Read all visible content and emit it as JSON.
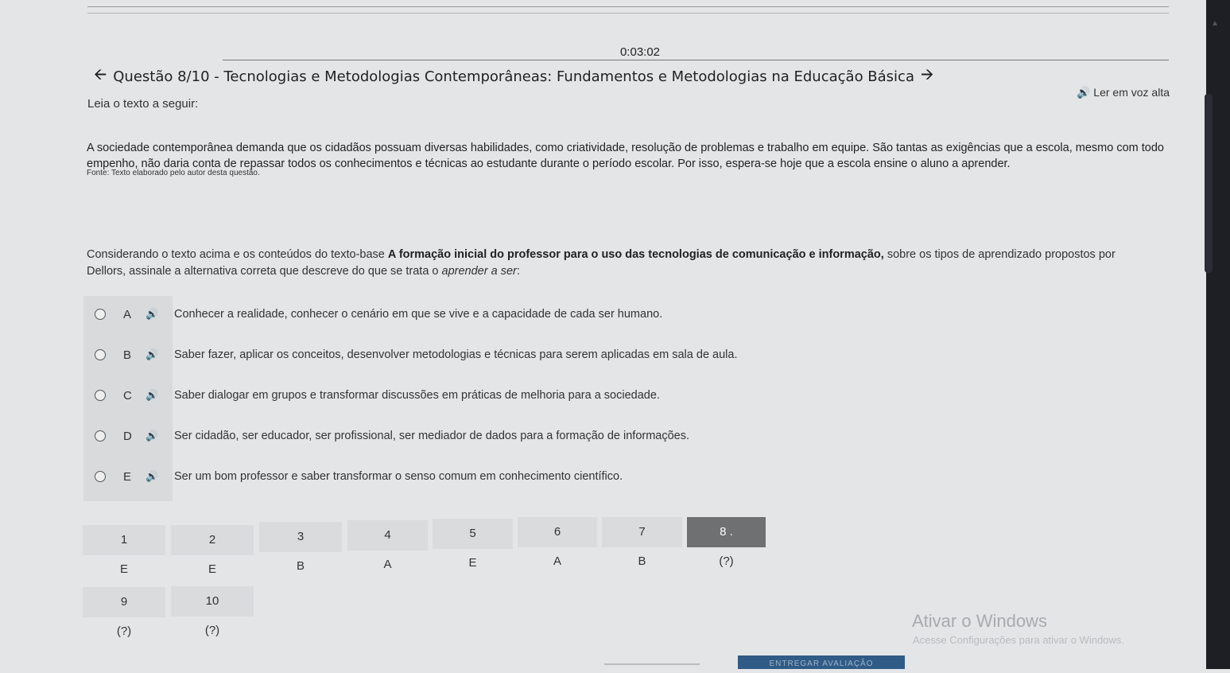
{
  "timer": "0:03:02",
  "question_title": "Questão 8/10 - Tecnologias e Metodologias Contemporâneas: Fundamentos e Metodologias na Educação Básica",
  "read_aloud_label": "Ler em voz alta",
  "lead": "Leia o texto a seguir:",
  "text_body": "A sociedade contemporânea demanda que os cidadãos possuam diversas habilidades, como criatividade, resolução de problemas e trabalho em equipe. São tantas as exigências que a escola, mesmo com todo empenho, não daria conta de repassar todos os conhecimentos e técnicas ao estudante durante o período escolar. Por isso, espera-se hoje que a escola ensine o aluno a aprender.",
  "source": "Fonte: Texto elaborado pelo autor desta questão.",
  "prompt": {
    "before": "Considerando o texto acima e os conteúdos do texto-base ",
    "bold": "A formação inicial do professor para o uso das tecnologias de comunicação e informação,",
    "after": " sobre os tipos de aprendizado propostos por Dellors, assinale a alternativa correta que descreve do que se trata o ",
    "italic": "aprender a ser",
    "end": ":"
  },
  "options": [
    {
      "letter": "A",
      "text": "Conhecer a realidade, conhecer o cenário em que se vive e a capacidade de cada ser humano."
    },
    {
      "letter": "B",
      "text": "Saber fazer, aplicar os conceitos, desenvolver metodologias e técnicas para serem aplicadas em sala de aula."
    },
    {
      "letter": "C",
      "text": "Saber dialogar em grupos e transformar discussões em práticas de melhoria para a sociedade."
    },
    {
      "letter": "D",
      "text": "Ser cidadão, ser educador, ser profissional, ser mediador de dados para a formação de informações."
    },
    {
      "letter": "E",
      "text": "Ser um bom professor e saber transformar o senso comum em conhecimento científico."
    }
  ],
  "navigation": [
    {
      "num": "1",
      "answer": "E"
    },
    {
      "num": "2",
      "answer": "E"
    },
    {
      "num": "3",
      "answer": "B"
    },
    {
      "num": "4",
      "answer": "A"
    },
    {
      "num": "5",
      "answer": "E"
    },
    {
      "num": "6",
      "answer": "A"
    },
    {
      "num": "7",
      "answer": "B"
    },
    {
      "num": "8 .",
      "answer": "(?)"
    },
    {
      "num": "9",
      "answer": "(?)"
    },
    {
      "num": "10",
      "answer": "(?)"
    }
  ],
  "windows_watermark": {
    "title": "Ativar o Windows",
    "subtitle": "Acesse Configurações para ativar o Windows."
  },
  "submit_label": "ENTREGAR AVALIAÇÃO",
  "icons": {
    "prev": "arrow-left-icon",
    "next": "arrow-right-icon",
    "speaker": "speaker-icon"
  }
}
